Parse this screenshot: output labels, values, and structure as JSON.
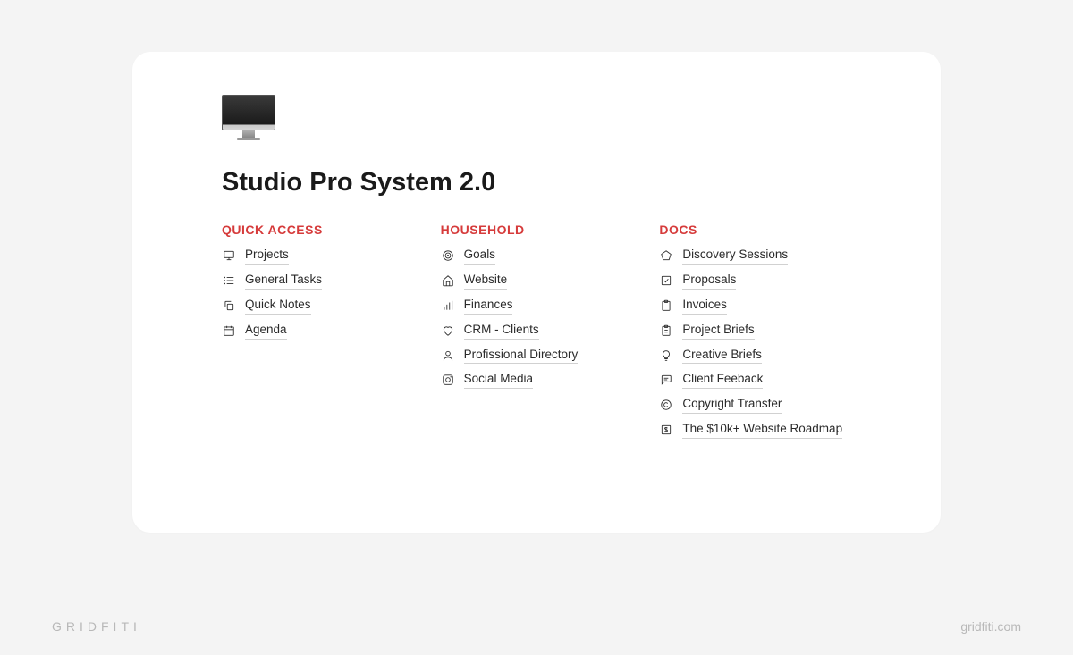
{
  "page": {
    "title": "Studio Pro System 2.0"
  },
  "sections": {
    "quick_access": {
      "header": "QUICK ACCESS",
      "items": [
        {
          "label": "Projects",
          "icon": "monitor-icon"
        },
        {
          "label": "General Tasks",
          "icon": "list-icon"
        },
        {
          "label": "Quick Notes",
          "icon": "copy-icon"
        },
        {
          "label": "Agenda",
          "icon": "calendar-icon"
        }
      ]
    },
    "household": {
      "header": "HOUSEHOLD",
      "items": [
        {
          "label": "Goals",
          "icon": "target-icon"
        },
        {
          "label": "Website",
          "icon": "home-icon"
        },
        {
          "label": "Finances",
          "icon": "bars-icon"
        },
        {
          "label": "CRM - Clients",
          "icon": "heart-icon"
        },
        {
          "label": "Profissional Directory",
          "icon": "user-icon"
        },
        {
          "label": "Social Media",
          "icon": "instagram-icon"
        }
      ]
    },
    "docs": {
      "header": "DOCS",
      "items": [
        {
          "label": "Discovery Sessions",
          "icon": "pentagon-icon"
        },
        {
          "label": "Proposals",
          "icon": "checkbox-icon"
        },
        {
          "label": "Invoices",
          "icon": "clipboard-icon"
        },
        {
          "label": "Project Briefs",
          "icon": "clipboard-list-icon"
        },
        {
          "label": "Creative Briefs",
          "icon": "bulb-icon"
        },
        {
          "label": "Client Feeback",
          "icon": "message-icon"
        },
        {
          "label": "Copyright Transfer",
          "icon": "copyright-icon"
        },
        {
          "label": "The $10k+ Website Roadmap",
          "icon": "dollar-icon"
        }
      ]
    }
  },
  "footer": {
    "brand": "GRIDFITI",
    "url": "gridfiti.com"
  }
}
